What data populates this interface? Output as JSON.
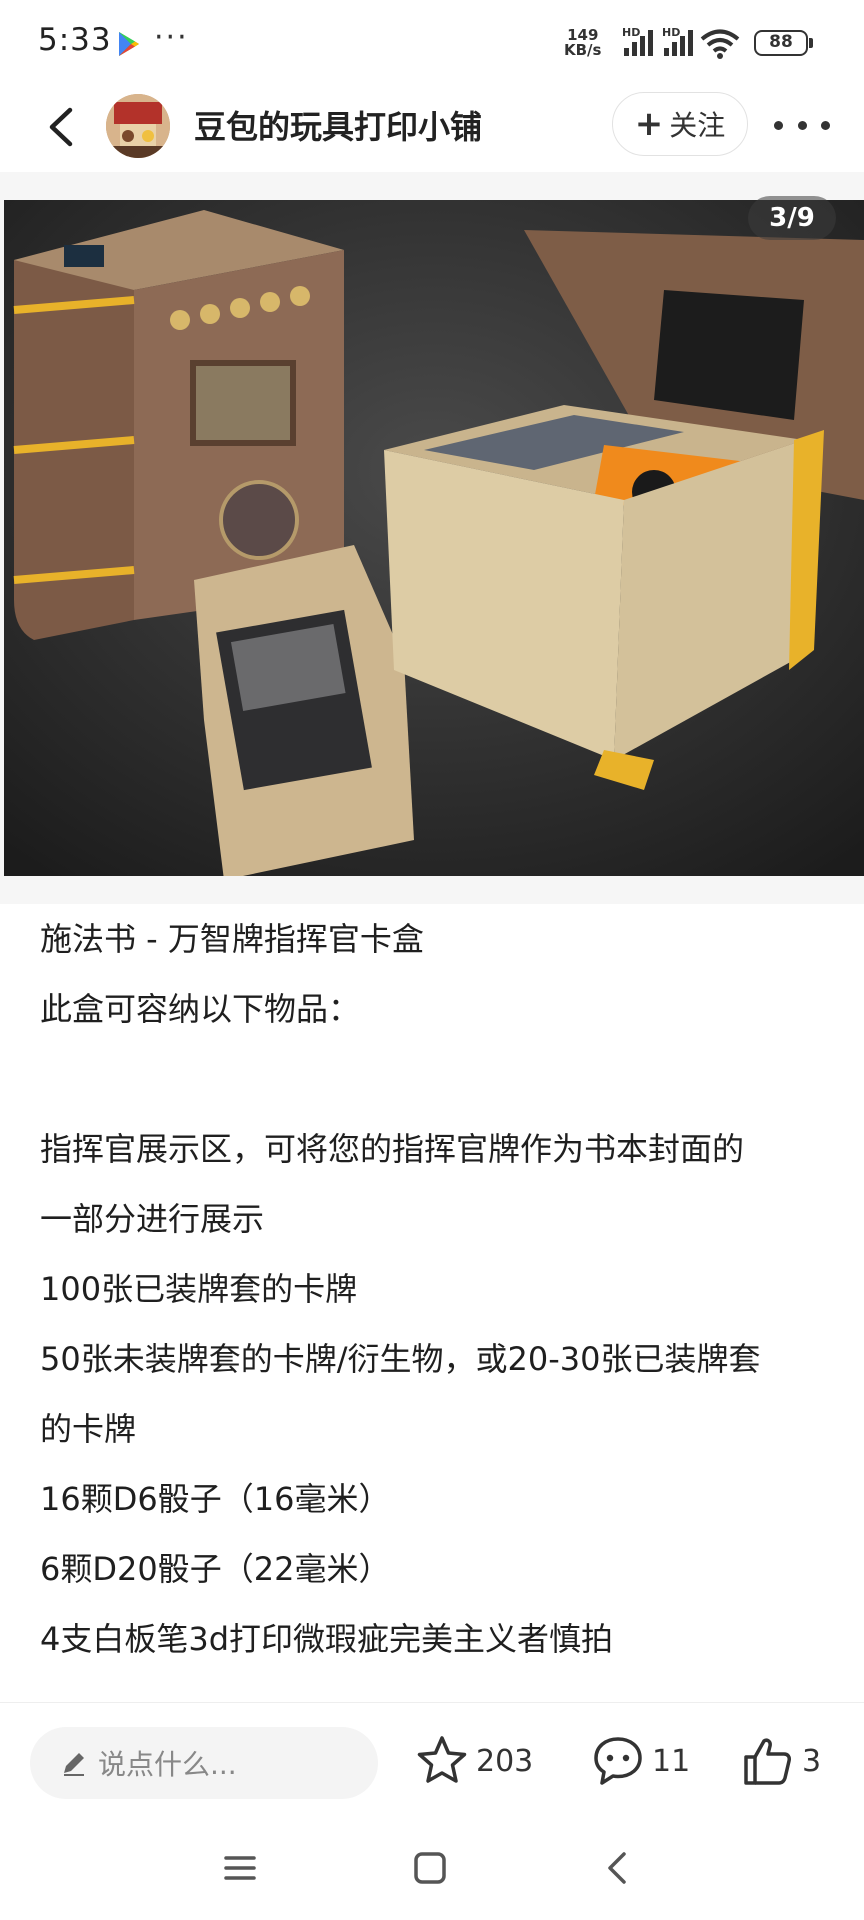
{
  "status_bar": {
    "time": "5:33",
    "more_dots": "···",
    "net_speed_value": "149",
    "net_speed_unit": "KB/s",
    "signal_1_label": "HD",
    "signal_2_label": "HD",
    "battery_level": "88"
  },
  "header": {
    "shop_name": "豆包的玩具打印小铺",
    "follow_label": "关注",
    "follow_plus": "+"
  },
  "gallery": {
    "counter": "3/9"
  },
  "post": {
    "lines": [
      "施法书 - 万智牌指挥官卡盒",
      "此盒可容纳以下物品：",
      "",
      "指挥官展示区，可将您的指挥官牌作为书本封面的",
      "一部分进行展示",
      "100张已装牌套的卡牌",
      "50张未装牌套的卡牌/衍生物，或20-30张已装牌套",
      "的卡牌",
      "16颗D6骰子（16毫米）",
      "6颗D20骰子（22毫米）",
      "4支白板笔3d打印微瑕疵完美主义者慎拍"
    ]
  },
  "bottom_bar": {
    "comment_placeholder": "说点什么...",
    "favorites_count": "203",
    "comments_count": "11",
    "likes_count": "3"
  },
  "colors": {
    "photo_bg": "#2b2b2b",
    "box_brown": "#8a6a55",
    "box_cream": "#e6d6b4",
    "accent_gold": "#e8b22a",
    "accent_orange": "#f08a1c"
  },
  "icons": [
    "play-store-icon",
    "wifi-icon",
    "back-arrow-icon",
    "star-icon",
    "comment-icon",
    "thumbs-up-icon",
    "pencil-icon",
    "nav-menu-icon",
    "nav-home-icon",
    "nav-back-icon"
  ]
}
